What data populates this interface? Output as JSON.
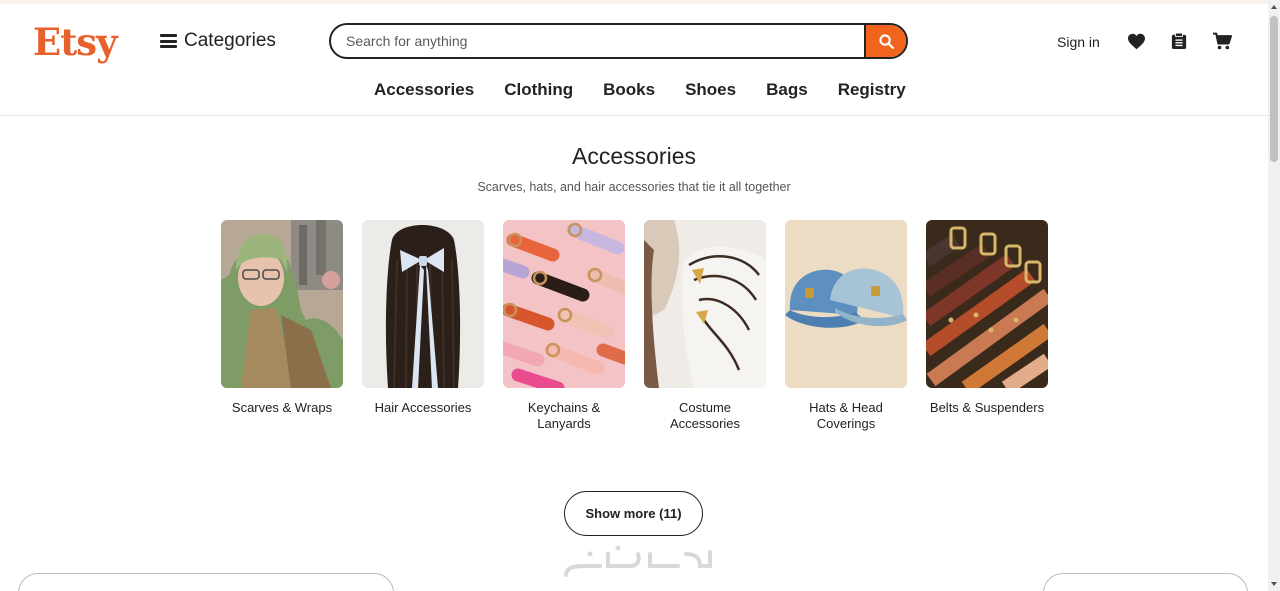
{
  "header": {
    "logo": "Etsy",
    "categories_label": "Categories",
    "search_placeholder": "Search for anything",
    "sign_in": "Sign in"
  },
  "nav": {
    "items": [
      "Accessories",
      "Clothing",
      "Books",
      "Shoes",
      "Bags",
      "Registry"
    ]
  },
  "section": {
    "title": "Accessories",
    "subtitle": "Scarves, hats, and hair accessories that tie it all together"
  },
  "cards": [
    {
      "label": "Scarves & Wraps",
      "image": "woman-green-scarf"
    },
    {
      "label": "Hair Accessories",
      "image": "braids-with-bow"
    },
    {
      "label": "Keychains & Lanyards",
      "image": "leather-keychains"
    },
    {
      "label": "Costume Accessories",
      "image": "butterfly-wings"
    },
    {
      "label": "Hats & Head Coverings",
      "image": "denim-caps"
    },
    {
      "label": "Belts & Suspenders",
      "image": "leather-belts"
    }
  ],
  "show_more": "Show more (11)",
  "colors": {
    "brand": "#e8612c",
    "search_button": "#f1641e"
  }
}
